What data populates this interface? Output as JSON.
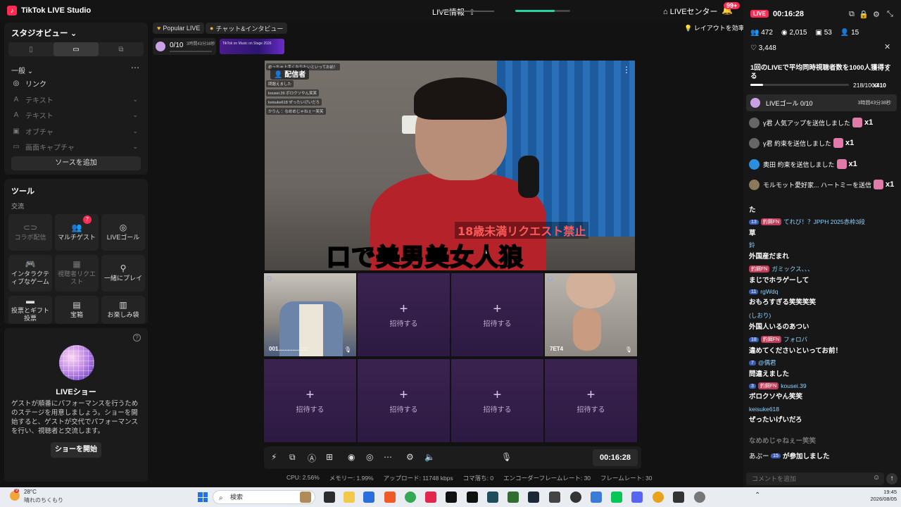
{
  "titlebar": {
    "app_title": "TikTok LIVE Studio",
    "live_info": "LIVE情報",
    "live_center": "LIVEセンター",
    "notif_count": "99+"
  },
  "studio": {
    "title": "スタジオビュー",
    "section": "一般",
    "sources": [
      {
        "icon": "link-icon",
        "label": "リンク",
        "active": true
      },
      {
        "icon": "text-icon",
        "label": "テキスト",
        "active": false
      },
      {
        "icon": "text-icon",
        "label": "テキスト",
        "active": false
      },
      {
        "icon": "object-icon",
        "label": "オブチャ",
        "active": false
      },
      {
        "icon": "screen-capture-icon",
        "label": "画面キャプチャ",
        "active": false
      }
    ],
    "add_source": "ソースを追加"
  },
  "tools": {
    "title": "ツール",
    "subtitle": "交流",
    "items": [
      {
        "label": "コラボ配信",
        "icon": "collab-icon",
        "dim": true
      },
      {
        "label": "マルチゲスト",
        "icon": "multi-guest-icon",
        "dim": false,
        "badge": "7"
      },
      {
        "label": "LIVEゴール",
        "icon": "goal-icon",
        "dim": false
      },
      {
        "label": "インタラクティブなゲーム",
        "icon": "gamepad-icon",
        "dim": false
      },
      {
        "label": "視聴者リクエスト",
        "icon": "request-icon",
        "dim": true
      },
      {
        "label": "一緒にプレイ",
        "icon": "play-together-icon",
        "dim": false
      },
      {
        "label": "投票とギフト投票",
        "icon": "poll-icon",
        "dim": false
      },
      {
        "label": "宝箱",
        "icon": "treasure-icon",
        "dim": false
      },
      {
        "label": "お楽しみ袋",
        "icon": "bag-icon",
        "dim": false
      }
    ]
  },
  "show": {
    "title": "LIVEショー",
    "description": "ゲストが順番にパフォーマンスを行うためのステージを用意しましょう。ショーを開始すると、ゲストが交代でパフォーマンスを行い、視聴者と交流します。",
    "start_button": "ショーを開始"
  },
  "center": {
    "chip_popular": "Popular LIVE",
    "chip_chat": "チャット&インタビュー",
    "goal_progress": "0/10",
    "goal_time": "3時間43分38秒",
    "banner_text": "TikTok on Music on Stage 2026",
    "layout_hint": "レイアウトを効率化",
    "broadcaster_tag": "配信者",
    "mini_comments": [
      "めっちゃ上手くなりたいといってお前！",
      "問題えました",
      "kousei.39 ボロクソやん笑笑",
      "keisuke618 ぜったいげいだろ",
      "かりん ：なめめじゃねぇー笑笑"
    ],
    "caption_small": "18歳未満リクエスト禁止",
    "caption_big": "口で美男美女人狼",
    "invite_label": "招待する",
    "guests": [
      {
        "name": "001..............::::"
      },
      {
        "name": "7ET4"
      }
    ],
    "timer": "00:16:28",
    "stats": [
      "CPU: 2.56%",
      "メモリー: 1.99%",
      "アップロード: 11748 kbps",
      "コマ落ち: 0",
      "エンコーダーフレームレート: 30",
      "フレームレート: 30"
    ]
  },
  "chat": {
    "live_label": "LIVE",
    "elapsed": "00:16:28",
    "viewers": "472",
    "views": "2,015",
    "gifts": "53",
    "follows": "15",
    "likes": "3,448",
    "goal_text": "1回のLIVEで平均同時視聴者数を1000人獲得する",
    "goal_count": "218/1000",
    "goal_mult": "x410",
    "goal_row_label": "LIVEゴール 0/10",
    "goal_row_time": "3時間43分38秒",
    "gifts_feed": [
      {
        "user": "γ君",
        "text": "人気アップを送信しました",
        "mult": "x1"
      },
      {
        "user": "γ君",
        "text": "約束を送信しました",
        "mult": "x1"
      },
      {
        "user": "奥田",
        "text": "約束を送信しました",
        "mult": "x1"
      },
      {
        "user": "モルモット愛好家...",
        "text": "ハートミーを送信",
        "mult": "x1"
      }
    ],
    "messages": [
      {
        "user": "",
        "text": "た",
        "badge": "",
        "fan": ""
      },
      {
        "user": "てれび！？JPPH 2025赤枠3段",
        "text": "草",
        "badge": "13",
        "fan": "釣餌FN"
      },
      {
        "user": "鈴",
        "text": "外国産だまれ",
        "badge": "",
        "fan": ""
      },
      {
        "user": "ガミックス、、、",
        "text": "まじでホラゲーして",
        "badge": "",
        "fan": "釣餌FN"
      },
      {
        "user": "rgWdq",
        "text": "おもろすぎる笑笑笑笑",
        "badge": "11",
        "fan": ""
      },
      {
        "user": "(しおり)",
        "text": "外国人いるのあつい",
        "badge": "",
        "fan": ""
      },
      {
        "user": "フォロバ",
        "text": "違めてくださいといってお前！",
        "badge": "18",
        "fan": "釣餌FN"
      },
      {
        "user": "@偶君",
        "text": "問違えました",
        "badge": "7",
        "fan": ""
      },
      {
        "user": "kousei.39",
        "text": "ボロクソやん笑笑",
        "badge": "3",
        "fan": "釣餌FN"
      },
      {
        "user": "keisuke618",
        "text": "ぜったいげいだろ",
        "badge": "",
        "fan": ""
      },
      {
        "user": "",
        "text": "なめめじゃねぇー笑笑",
        "badge": "",
        "fan": ""
      },
      {
        "user": "あぷー",
        "text": "が参加しました",
        "badge": "15",
        "fan": ""
      }
    ],
    "input_placeholder": "コメントを追加"
  },
  "taskbar": {
    "temp": "28°C",
    "weather": "晴れのちくもり",
    "weather_badge": "9",
    "search": "検索",
    "time": "19:45",
    "date": "2026/08/05"
  }
}
